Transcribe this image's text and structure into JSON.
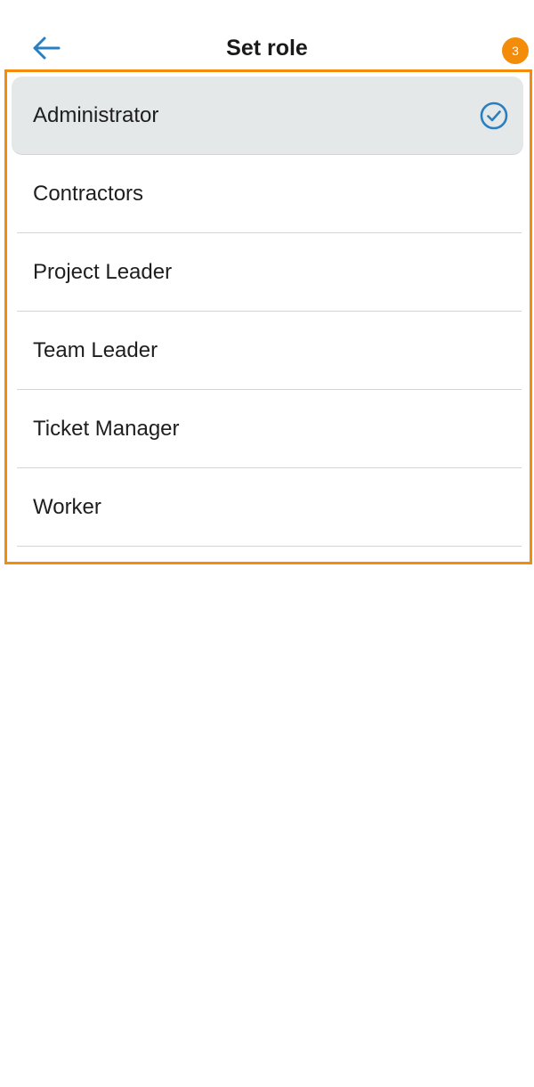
{
  "header": {
    "title": "Set role",
    "back_icon": "arrow-left-icon"
  },
  "annotation": {
    "badge": "3",
    "color": "#f28c0a"
  },
  "colors": {
    "accent": "#2a7fc1",
    "selected_background": "#e4e8e9",
    "divider": "#d4d4d4"
  },
  "roles": [
    {
      "label": "Administrator",
      "selected": true
    },
    {
      "label": "Contractors",
      "selected": false
    },
    {
      "label": "Project Leader",
      "selected": false
    },
    {
      "label": "Team Leader",
      "selected": false
    },
    {
      "label": "Ticket Manager",
      "selected": false
    },
    {
      "label": "Worker",
      "selected": false
    }
  ],
  "selected_icon": "check-circle-icon"
}
